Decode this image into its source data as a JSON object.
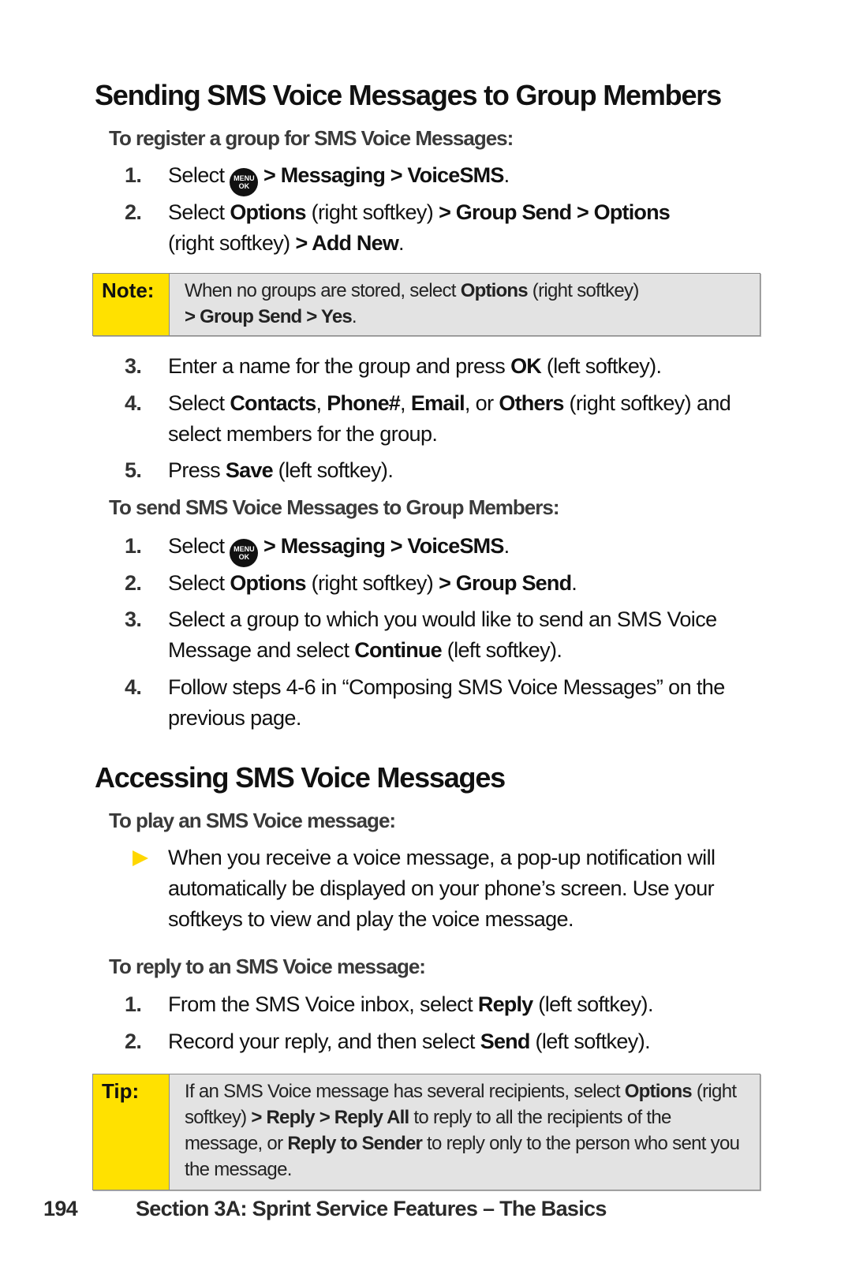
{
  "section1": {
    "title": "Sending SMS Voice Messages to Group Members",
    "register": {
      "heading": "To register a group for SMS Voice Messages:",
      "steps": [
        {
          "num": "1.",
          "parts": {
            "a": "Select ",
            "icon": "menu-ok-icon",
            "b": " > Messaging > VoiceSMS",
            "c": "."
          }
        },
        {
          "num": "2.",
          "parts": {
            "a": "Select ",
            "b1": "Options",
            "c1": " (right softkey) ",
            "b2": "> Group Send > Options",
            "c2": " (right softkey) ",
            "b3": "> Add New",
            "c3": "."
          }
        }
      ],
      "note": {
        "label": "Note:",
        "a": "When no groups are stored, select ",
        "b1": "Options",
        "c1": " (right softkey) ",
        "b2": "> Group Send > Yes",
        "c2": "."
      },
      "steps2": [
        {
          "num": "3.",
          "a": "Enter a name for the group and press ",
          "b": "OK",
          "c": " (left softkey)."
        },
        {
          "num": "4.",
          "a": "Select ",
          "b1": "Contacts",
          "s1": ", ",
          "b2": "Phone#",
          "s2": ", ",
          "b3": "Email",
          "s3": ", or ",
          "b4": "Others",
          "c": " (right softkey) and select members for the group."
        },
        {
          "num": "5.",
          "a": "Press ",
          "b": "Save",
          "c": " (left softkey)."
        }
      ]
    },
    "send": {
      "heading": "To send SMS Voice Messages to Group Members:",
      "steps": [
        {
          "num": "1.",
          "a": "Select ",
          "b": " > Messaging > VoiceSMS",
          "c": "."
        },
        {
          "num": "2.",
          "a": "Select ",
          "b1": "Options",
          "c1": " (right softkey) ",
          "b2": "> Group Send",
          "c2": "."
        },
        {
          "num": "3.",
          "a": "Select a group to which you would like to send an SMS Voice Message and select ",
          "b": "Continue",
          "c": " (left softkey)."
        },
        {
          "num": "4.",
          "a": "Follow steps 4-6 in “Composing SMS Voice Messages” on the previous page."
        }
      ]
    }
  },
  "section2": {
    "title": "Accessing SMS Voice Messages",
    "play": {
      "heading": "To play an SMS Voice message:",
      "bullet": "When you receive a voice message, a pop-up notification will automatically be displayed on your phone’s screen. Use your softkeys to view and play the voice message."
    },
    "reply": {
      "heading": "To reply to an SMS Voice message:",
      "steps": [
        {
          "num": "1.",
          "a": "From the SMS Voice inbox, select ",
          "b": "Reply",
          "c": " (left softkey)."
        },
        {
          "num": "2.",
          "a": "Record your reply, and then select ",
          "b": "Send",
          "c": " (left softkey)."
        }
      ],
      "tip": {
        "label": "Tip:",
        "a": "If an SMS Voice message has several recipients, select ",
        "b1": "Options",
        "c1": " (right softkey) ",
        "b2": "> Reply > Reply All",
        "c2": " to reply to all the recipients of the message, or ",
        "b3": "Reply to Sender",
        "c3": " to reply only to the person who sent you the message."
      }
    }
  },
  "icons": {
    "menu_top": "MENU",
    "menu_bottom": "OK"
  },
  "footer": {
    "page_number": "194",
    "section": "Section 3A: Sprint Service Features – The Basics"
  },
  "colors": {
    "accent_yellow": "#ffe100",
    "box_gray": "#e3e3e3"
  }
}
